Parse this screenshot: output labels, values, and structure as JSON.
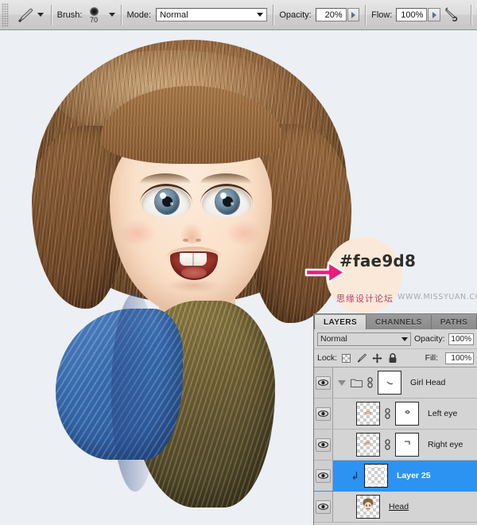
{
  "options_bar": {
    "tool_icon": "brush-icon",
    "tool_preset_caret": "chevron-down-icon",
    "brush_label": "Brush:",
    "brush_size": "70",
    "brush_caret": "chevron-down-icon",
    "mode_label": "Mode:",
    "mode_value": "Normal",
    "opacity_label": "Opacity:",
    "opacity_value": "20%",
    "flow_label": "Flow:",
    "flow_value": "100%",
    "airbrush_icon": "airbrush-icon"
  },
  "annotation": {
    "color_hex_label": "#fae9d8",
    "swatch_color": "#fae9d8",
    "arrow_color": "#ec1a7a",
    "watermark_cn": "思缘设计论坛",
    "watermark_en": "WWW.MISSYUAN.COM"
  },
  "layers_panel": {
    "tabs": [
      {
        "label": "LAYERS",
        "active": true
      },
      {
        "label": "CHANNELS",
        "active": false
      },
      {
        "label": "PATHS",
        "active": false
      }
    ],
    "blend_mode": "Normal",
    "opacity_label": "Opacity:",
    "opacity_value": "100%",
    "lock_label": "Lock:",
    "lock_icons": [
      "lock-transparency-icon",
      "lock-image-icon",
      "lock-position-icon",
      "lock-all-icon"
    ],
    "fill_label": "Fill:",
    "fill_value": "100%",
    "selection_color": "#2d93f2",
    "rows": [
      {
        "name": "Girl Head",
        "kind": "group",
        "visible": true,
        "selected": false,
        "expanded": true,
        "has_link": true,
        "has_mask": true,
        "indent": 0,
        "clipped": false,
        "underline": false
      },
      {
        "name": "Left eye",
        "kind": "layer",
        "visible": true,
        "selected": false,
        "expanded": false,
        "has_link": true,
        "has_mask": true,
        "indent": 1,
        "clipped": false,
        "underline": false
      },
      {
        "name": "Right eye",
        "kind": "layer",
        "visible": true,
        "selected": false,
        "expanded": false,
        "has_link": true,
        "has_mask": true,
        "indent": 1,
        "clipped": false,
        "underline": false
      },
      {
        "name": "Layer 25",
        "kind": "layer",
        "visible": true,
        "selected": true,
        "expanded": false,
        "has_link": false,
        "has_mask": false,
        "indent": 1,
        "clipped": true,
        "underline": false
      },
      {
        "name": "Head",
        "kind": "layer",
        "visible": true,
        "selected": false,
        "expanded": false,
        "has_link": false,
        "has_mask": false,
        "indent": 1,
        "clipped": false,
        "underline": true
      }
    ]
  }
}
